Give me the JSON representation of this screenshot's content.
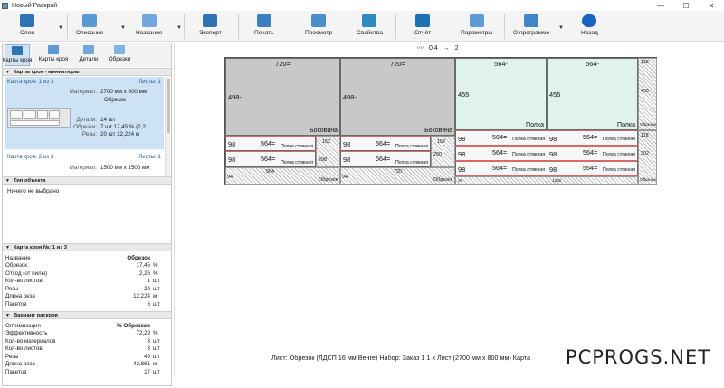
{
  "window": {
    "title": "Новый Раскрой",
    "controls": [
      "—",
      "☐",
      "✕"
    ]
  },
  "toolbar": {
    "items": [
      {
        "label": "Слои",
        "icon": "layers-icon",
        "color": "#2e74b5"
      },
      {
        "label": "Описание",
        "icon": "description-icon",
        "color": "#5a9ad1"
      },
      {
        "label": "Название",
        "icon": "label-icon",
        "color": "#6fa8dc"
      },
      {
        "label": "Экспорт",
        "icon": "export-icon",
        "color": "#2e74b5"
      },
      {
        "label": "Печать",
        "icon": "print-icon",
        "color": "#3d7fc1"
      },
      {
        "label": "Просмотр",
        "icon": "preview-icon",
        "color": "#4a8ccc"
      },
      {
        "label": "Свойства",
        "icon": "properties-icon",
        "color": "#2e8bc0"
      },
      {
        "label": "Отчёт",
        "icon": "report-icon",
        "color": "#1f6fb5"
      },
      {
        "label": "Параметры",
        "icon": "settings-icon",
        "color": "#5c9bd6"
      },
      {
        "label": "О программе",
        "icon": "about-icon",
        "color": "#3f86c8"
      },
      {
        "label": "Назад",
        "icon": "back-icon",
        "color": "#1565c0"
      }
    ]
  },
  "left_panel": {
    "tabs": [
      {
        "label": "Карты кроя",
        "icon": "cut-maps-icon"
      },
      {
        "label": "Карты кроя",
        "icon": "cut-maps-alt-icon"
      },
      {
        "label": "Детали",
        "icon": "parts-icon"
      },
      {
        "label": "Обрезки",
        "icon": "offcuts-icon"
      }
    ],
    "cut_maps_header": "Карты кроя - миниатюры",
    "card1": {
      "title": "Карта кроя: 1 из 3",
      "sheets": "Листы: 1",
      "material_k": "Материал:",
      "material_v": "2700 мм x 800 мм",
      "material_sub": "Обрезок",
      "parts_k": "Детали:",
      "parts_v": "14 шт",
      "offcuts_k": "Обрезки:",
      "offcuts_v": "7 шт 17,45 % (2,2",
      "cuts_k": "Резы:",
      "cuts_v": "20 шт 12,224 м"
    },
    "card2": {
      "title": "Карта кроя: 2 из 3",
      "sheets": "Листы: 1",
      "material_k": "Материал:",
      "material_v": "1500 мм x 1500 мм"
    },
    "object_type_header": "Тип объекта",
    "object_type_text": "Ничего не выбрано",
    "cutmap_header": "Карта кроя №: 1 из 3",
    "cutmap_rows": [
      {
        "name": "Название",
        "value": "Обрезок",
        "unit": ""
      },
      {
        "name": "Обрезок",
        "value": "17,45",
        "unit": "%"
      },
      {
        "name": "Отход (от пилы)",
        "value": "2,26",
        "unit": "%"
      },
      {
        "name": "Кол-во листов",
        "value": "1",
        "unit": "шт"
      },
      {
        "name": "Резы",
        "value": "20",
        "unit": "шт"
      },
      {
        "name": "Длина реза",
        "value": "12,224",
        "unit": "м"
      },
      {
        "name": "Пакетов",
        "value": "6",
        "unit": "шт"
      }
    ],
    "variant_header": "Вариант раскроя",
    "variant_rows": [
      {
        "name": "Оптимизация",
        "value": "% Обрезков",
        "unit": ""
      },
      {
        "name": "Эффективность",
        "value": "72,29",
        "unit": "%"
      },
      {
        "name": "Кол-во материалов",
        "value": "3",
        "unit": "шт"
      },
      {
        "name": "Кол-во листов",
        "value": "3",
        "unit": "шт"
      },
      {
        "name": "Резы",
        "value": "49",
        "unit": "шт"
      },
      {
        "name": "Длина реза",
        "value": "42,861",
        "unit": "м"
      },
      {
        "name": "Пакетов",
        "value": "17",
        "unit": "шт"
      }
    ]
  },
  "main": {
    "thickness_legend": {
      "a": "0.4",
      "b": "2"
    },
    "big_parts": [
      {
        "w": "720=",
        "h": "498-",
        "name": "Боковина",
        "color": "#c8c8c8"
      },
      {
        "w": "720=",
        "h": "498-",
        "name": "Боковина",
        "color": "#c8c8c8"
      },
      {
        "w": "564-",
        "h": "455",
        "name": "Полка",
        "color": "#dff3ec"
      },
      {
        "w": "564-",
        "h": "455",
        "name": "Полка",
        "color": "#dff3ec"
      }
    ],
    "strip_part": {
      "w": "564=",
      "h": "98",
      "name": "Полка стяжная"
    },
    "offcut_label": "Обрезок",
    "dims": {
      "right_top": "118",
      "right_mid": "455",
      "right_offcut": "Обрезок",
      "right_b1": "118",
      "right_b2": "302",
      "right_b3": "Обрезок",
      "col1_a": "152",
      "col1_b": "298",
      "col2_a": "152",
      "col2_b": "200",
      "bottom_94a": "94",
      "bottom_564": "564",
      "bottom_94b": "94",
      "bottom_720": "720",
      "bottom_38": "38",
      "bottom_1282": "1282"
    },
    "status_line": "Лист: Обрезок (ЛДСП 16 мм Венге)  Набор: Заказ 1   1 x Лист (2700 мм x 800 мм)  Карта"
  },
  "watermark": "PCPROGS.NET"
}
